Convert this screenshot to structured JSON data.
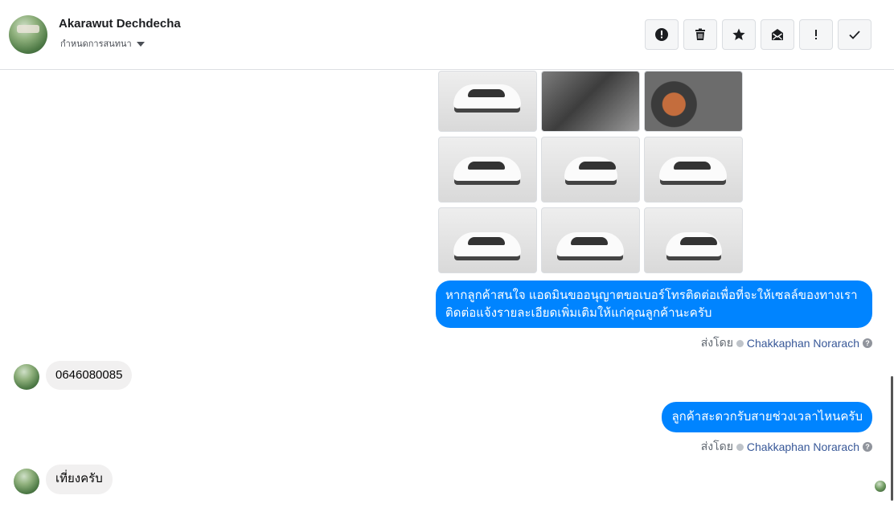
{
  "header": {
    "contact_name": "Akarawut Dechdecha",
    "assign_label": "กำหนดการสนทนา",
    "toolbar": [
      {
        "icon": "alert-circle-icon",
        "label": "spam"
      },
      {
        "icon": "trash-icon",
        "label": "delete"
      },
      {
        "icon": "star-icon",
        "label": "star"
      },
      {
        "icon": "mail-icon",
        "label": "mark-unread"
      },
      {
        "icon": "exclamation-icon",
        "label": "follow-up"
      },
      {
        "icon": "check-icon",
        "label": "done"
      }
    ]
  },
  "photos": {
    "count": 9,
    "subjects": [
      "car-side",
      "car-interior",
      "car-dashboard",
      "car-front-left",
      "car-rear",
      "car-rear-right",
      "car-front-left-2",
      "car-front",
      "car-front-2"
    ]
  },
  "messages": [
    {
      "direction": "out",
      "lines": [
        "หากลูกค้าสนใจ แอดมินขออนุญาตขอเบอร์โทรติดต่อเพื่อที่จะให้เซลล์ของทางเรา",
        "ติดต่อแจ้งรายละเอียดเพิ่มเติมให้แก่คุณลูกค้านะครับ"
      ],
      "sent_by_label": "ส่งโดย",
      "agent": "Chakkaphan Norarach"
    },
    {
      "direction": "in",
      "text": "0646080085"
    },
    {
      "direction": "out",
      "text": "ลูกค้าสะดวกรับสายช่วงเวลาไหนครับ",
      "sent_by_label": "ส่งโดย",
      "agent": "Chakkaphan Norarach"
    },
    {
      "direction": "in",
      "text": "เที่ยงครับ"
    }
  ],
  "colors": {
    "outgoing_bubble": "#0084ff",
    "incoming_bubble": "#f1f0f0",
    "agent_link": "#385898"
  }
}
